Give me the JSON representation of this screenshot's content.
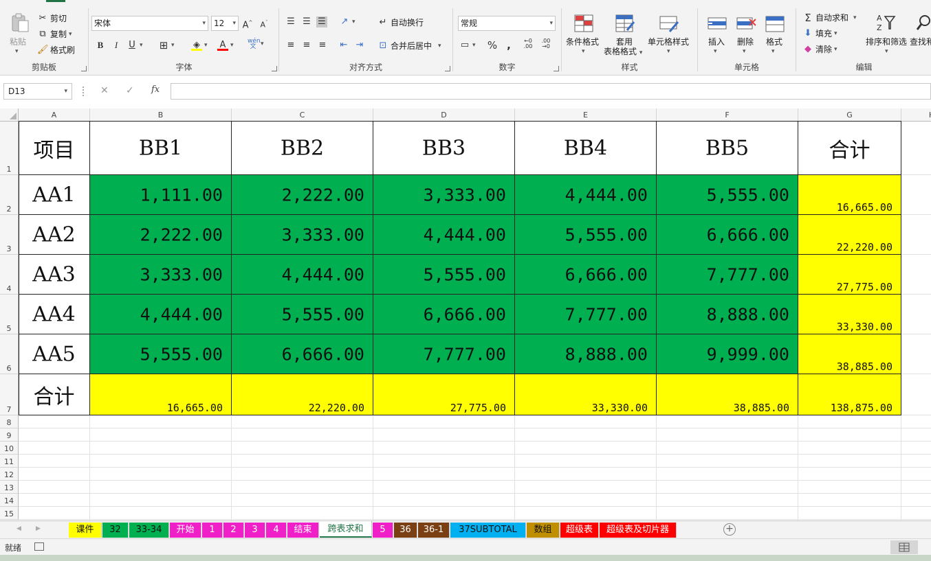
{
  "ribbon": {
    "clipboard": {
      "title": "剪贴板",
      "paste": "粘贴",
      "cut": "剪切",
      "copy": "复制",
      "format_painter": "格式刷"
    },
    "font": {
      "title": "字体",
      "font_name": "宋体",
      "font_size": "12"
    },
    "alignment": {
      "title": "对齐方式",
      "wrap_text": "自动换行",
      "merge_center": "合并后居中"
    },
    "number": {
      "title": "数字",
      "format": "常规"
    },
    "styles": {
      "title": "样式",
      "conditional": "条件格式",
      "table_format_1": "套用",
      "table_format_2": "表格格式",
      "cell_styles": "单元格样式"
    },
    "cells": {
      "title": "单元格",
      "insert": "插入",
      "delete": "删除",
      "format": "格式"
    },
    "editing": {
      "title": "编辑",
      "autosum": "自动求和",
      "fill": "填充",
      "clear": "清除",
      "sort_filter": "排序和筛选",
      "find_select": "查找和"
    }
  },
  "formula_bar": {
    "name_box": "D13",
    "fx": "fx",
    "value": ""
  },
  "grid": {
    "columns": [
      "A",
      "B",
      "C",
      "D",
      "E",
      "F",
      "G",
      "H"
    ],
    "rows": [
      "1",
      "2",
      "3",
      "4",
      "5",
      "6",
      "7",
      "8",
      "9",
      "10",
      "11",
      "12",
      "13",
      "14",
      "15"
    ]
  },
  "table": {
    "corner_label": "项目",
    "col_headers": [
      "BB1",
      "BB2",
      "BB3",
      "BB4",
      "BB5",
      "合计"
    ],
    "rows": [
      {
        "label": "AA1",
        "values": [
          "1,111.00",
          "2,222.00",
          "3,333.00",
          "4,444.00",
          "5,555.00"
        ],
        "total": "16,665.00"
      },
      {
        "label": "AA2",
        "values": [
          "2,222.00",
          "3,333.00",
          "4,444.00",
          "5,555.00",
          "6,666.00"
        ],
        "total": "22,220.00"
      },
      {
        "label": "AA3",
        "values": [
          "3,333.00",
          "4,444.00",
          "5,555.00",
          "6,666.00",
          "7,777.00"
        ],
        "total": "27,775.00"
      },
      {
        "label": "AA4",
        "values": [
          "4,444.00",
          "5,555.00",
          "6,666.00",
          "7,777.00",
          "8,888.00"
        ],
        "total": "33,330.00"
      },
      {
        "label": "AA5",
        "values": [
          "5,555.00",
          "6,666.00",
          "7,777.00",
          "8,888.00",
          "9,999.00"
        ],
        "total": "38,885.00"
      }
    ],
    "total_row": {
      "label": "合计",
      "values": [
        "16,665.00",
        "22,220.00",
        "27,775.00",
        "33,330.00",
        "38,885.00"
      ],
      "grand_total": "138,875.00"
    }
  },
  "colors": {
    "green": "#00b050",
    "yellow": "#ffff00",
    "accent": "#217346"
  },
  "sheet_tabs": [
    {
      "label": "课件",
      "color": "#ffff00",
      "text": "#111"
    },
    {
      "label": "32",
      "color": "#00b050",
      "text": "#111"
    },
    {
      "label": "33-34",
      "color": "#00b050",
      "text": "#111"
    },
    {
      "label": "开始",
      "color": "#f020c8",
      "text": "#fff"
    },
    {
      "label": "1",
      "color": "#f020c8",
      "text": "#fff"
    },
    {
      "label": "2",
      "color": "#f020c8",
      "text": "#fff"
    },
    {
      "label": "3",
      "color": "#f020c8",
      "text": "#fff"
    },
    {
      "label": "4",
      "color": "#f020c8",
      "text": "#fff"
    },
    {
      "label": "结束",
      "color": "#f020c8",
      "text": "#fff"
    },
    {
      "label": "跨表求和",
      "color": "#ffffff",
      "text": "#217346",
      "active": true
    },
    {
      "label": "5",
      "color": "#f020c8",
      "text": "#fff"
    },
    {
      "label": "36",
      "color": "#7b3f14",
      "text": "#fff"
    },
    {
      "label": "36-1",
      "color": "#7b3f14",
      "text": "#fff"
    },
    {
      "label": "37SUBTOTAL",
      "color": "#00b0f0",
      "text": "#111"
    },
    {
      "label": "数组",
      "color": "#bf8f00",
      "text": "#111"
    },
    {
      "label": "超级表",
      "color": "#ff0000",
      "text": "#fff"
    },
    {
      "label": "超级表及切片器",
      "color": "#ff0000",
      "text": "#fff"
    }
  ],
  "status": {
    "ready": "就绪"
  }
}
